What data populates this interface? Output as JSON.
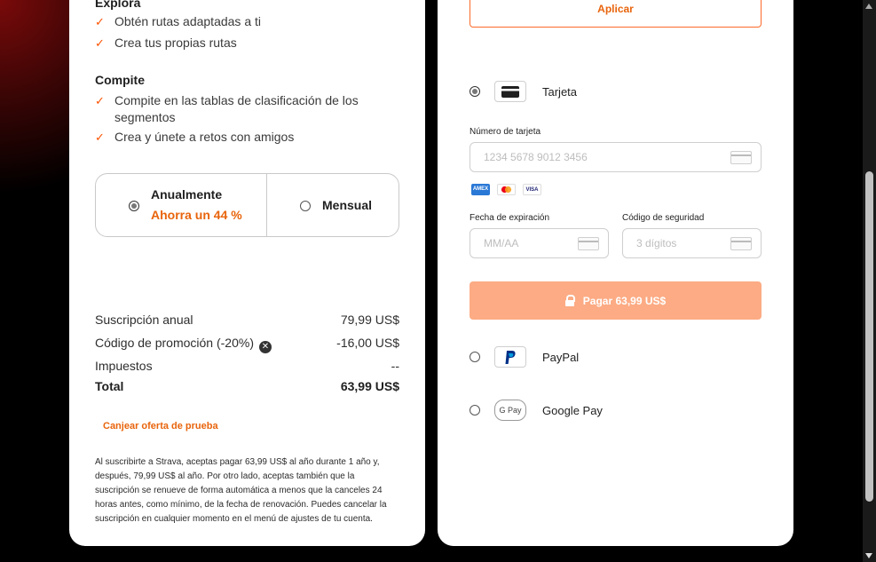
{
  "features": {
    "explore_heading": "Explora",
    "explore_items": [
      "Obtén rutas adaptadas a ti",
      "Crea tus propias rutas"
    ],
    "compete_heading": "Compite",
    "compete_items": [
      "Compite en las tablas de clasificación de los segmentos",
      "Crea y únete a retos con amigos"
    ]
  },
  "plans": {
    "annual_label": "Anualmente",
    "annual_savings": "Ahorra un 44 %",
    "monthly_label": "Mensual",
    "selected": "annual"
  },
  "summary": {
    "annual_label": "Suscripción anual",
    "annual_value": "79,99 US$",
    "promo_label": "Código de promoción (-20%)",
    "promo_value": "-16,00 US$",
    "tax_label": "Impuestos",
    "tax_value": "--",
    "total_label": "Total",
    "total_value": "63,99 US$"
  },
  "trial_link": "Canjear oferta de prueba",
  "legal_text": "Al suscribirte a Strava, aceptas pagar 63,99 US$ al año durante 1 año y, después, 79,99 US$ al año. Por otro lado, aceptas también que la suscripción se renueve de forma automática a menos que la canceles 24 horas antes, como mínimo, de la fecha de renovación. Puedes cancelar la suscripción en cualquier momento en el menú de ajustes de tu cuenta.",
  "payment": {
    "apply_label": "Aplicar",
    "card_label": "Tarjeta",
    "card_number_label": "Número de tarjeta",
    "card_number_placeholder": "1234 5678 9012 3456",
    "brands": [
      "AMEX",
      "mastercard",
      "VISA"
    ],
    "expiry_label": "Fecha de expiración",
    "expiry_placeholder": "MM/AA",
    "cvc_label": "Código de seguridad",
    "cvc_placeholder": "3 dígitos",
    "pay_label": "Pagar 63,99 US$",
    "paypal_label": "PayPal",
    "gpay_label": "Google Pay",
    "gpay_icon_text": "G Pay",
    "selected_method": "card"
  },
  "colors": {
    "accent": "#fc5200",
    "accent_text": "#e8640c",
    "pay_button_disabled": "#fcab84"
  }
}
